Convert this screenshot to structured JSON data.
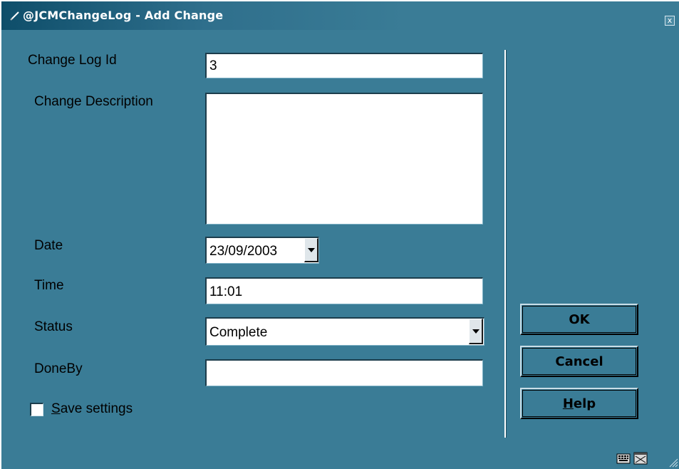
{
  "window": {
    "title": "@JCMChangeLog - Add Change",
    "close_glyph": "x"
  },
  "form": {
    "change_log_id": {
      "label": "Change Log Id",
      "value": "3"
    },
    "change_description": {
      "label": "Change Description",
      "value": ""
    },
    "date": {
      "label": "Date",
      "value": "23/09/2003"
    },
    "time": {
      "label": "Time",
      "value": "11:01"
    },
    "status": {
      "label": "Status",
      "value": "Complete"
    },
    "done_by": {
      "label": "DoneBy",
      "value": ""
    },
    "save_settings": {
      "label_underlined": "S",
      "label_rest": "ave settings",
      "checked": false
    }
  },
  "buttons": {
    "ok": "OK",
    "cancel": "Cancel",
    "help_underlined": "H",
    "help_rest": "elp"
  },
  "icons": {
    "title": "pen-icon",
    "status_left": "keyboard-icon",
    "status_right": "window-icon"
  },
  "colors": {
    "background": "#3a7c96",
    "titlebar_dark": "#0e4e6a"
  }
}
